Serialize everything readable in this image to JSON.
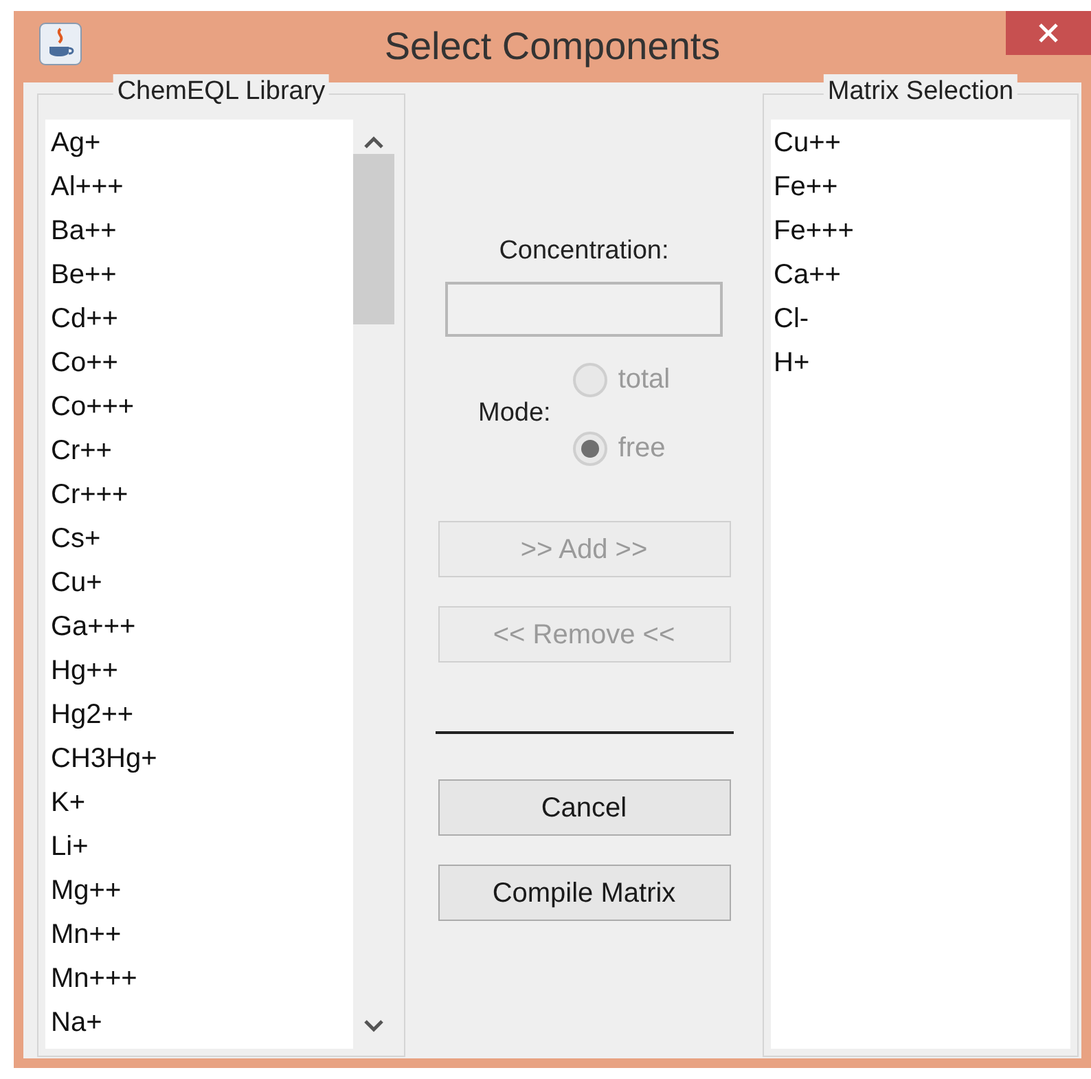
{
  "window": {
    "title": "Select Components"
  },
  "library": {
    "title": "ChemEQL Library",
    "items": [
      "Ag+",
      "Al+++",
      "Ba++",
      "Be++",
      "Cd++",
      "Co++",
      "Co+++",
      "Cr++",
      "Cr+++",
      "Cs+",
      "Cu+",
      "Ga+++",
      "Hg++",
      "Hg2++",
      "CH3Hg+",
      "K+",
      "Li+",
      "Mg++",
      "Mn++",
      "Mn+++",
      "Na+"
    ]
  },
  "concentration": {
    "label": "Concentration:"
  },
  "mode": {
    "label": "Mode:",
    "options": [
      {
        "label": "total",
        "selected": false,
        "disabled": true
      },
      {
        "label": "free",
        "selected": true,
        "disabled": true
      }
    ]
  },
  "action_buttons": [
    {
      "label": ">> Add >>",
      "disabled": true
    },
    {
      "label": "<< Remove <<",
      "disabled": true
    }
  ],
  "dialog_buttons": [
    {
      "label": "Cancel",
      "disabled": false
    },
    {
      "label": "Compile Matrix",
      "disabled": false
    }
  ],
  "matrix": {
    "title": "Matrix Selection",
    "items": [
      "Cu++",
      "Fe++",
      "Fe+++",
      "Ca++",
      "Cl-",
      "H+"
    ]
  }
}
